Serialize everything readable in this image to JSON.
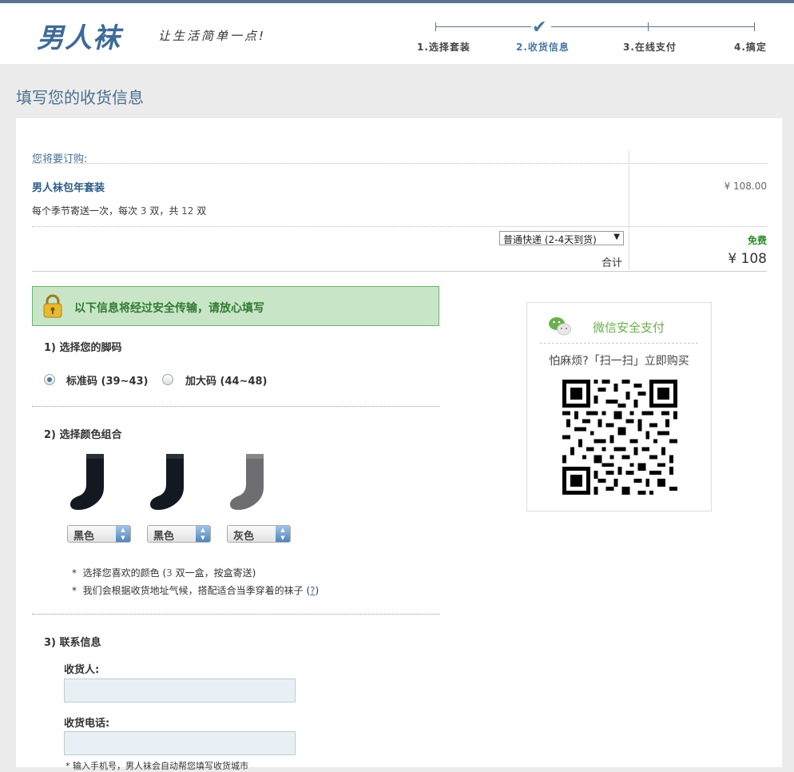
{
  "header": {
    "logo": "男人袜",
    "slogan": "让生活简单一点!",
    "steps": [
      "1.选择套装",
      "2.收货信息",
      "3.在线支付",
      "4.搞定"
    ],
    "active_step": 1
  },
  "page_title": "填写您的收货信息",
  "order": {
    "heading": "您将要订购:",
    "product_name": "男人袜包年套装",
    "desc_prefix": "每个季节寄送一次，每次",
    "desc_n1": "3",
    "desc_mid1": "双，共",
    "desc_n2": "12",
    "desc_suffix": "双",
    "price": "¥ 108.00",
    "shipping_option": "普通快递 (2-4天到货)",
    "shipping_fee": "免费",
    "total_label": "合计",
    "total_value": "¥ 108"
  },
  "secure_notice": "以下信息将经过安全传输，请放心填写",
  "size_section": {
    "title": "1) 选择您的脚码",
    "options": [
      {
        "label": "标准码 (39~43)",
        "selected": true
      },
      {
        "label": "加大码 (44~48)",
        "selected": false
      }
    ]
  },
  "color_section": {
    "title": "2) 选择颜色组合",
    "socks": [
      {
        "color_name": "黑色",
        "color": "#141820"
      },
      {
        "color_name": "黑色",
        "color": "#141820"
      },
      {
        "color_name": "灰色",
        "color": "#6e6e70"
      }
    ],
    "note1_a": "选择您喜欢的颜色 (",
    "note1_b": "3",
    "note1_c": " 双一盒，按盒寄送)",
    "note2_a": "我们会根据收货地址气候，搭配适合当季穿着的袜子 (",
    "note2_q": "?",
    "note2_c": ")"
  },
  "contact_section": {
    "title": "3) 联系信息",
    "receiver_label": "收货人:",
    "receiver_value": "",
    "phone_label": "收货电话:",
    "phone_value": "",
    "hint": "* 输入手机号，男人袜会自动帮您填写收货城市"
  },
  "wechat": {
    "title": "微信安全支付",
    "subtitle": "怕麻烦?「扫一扫」立即购买"
  },
  "colors": {
    "accent": "#4a78a4",
    "title_blue": "#4a6f92",
    "green": "#2f7a2f",
    "wechat_green": "#6ab04c"
  }
}
